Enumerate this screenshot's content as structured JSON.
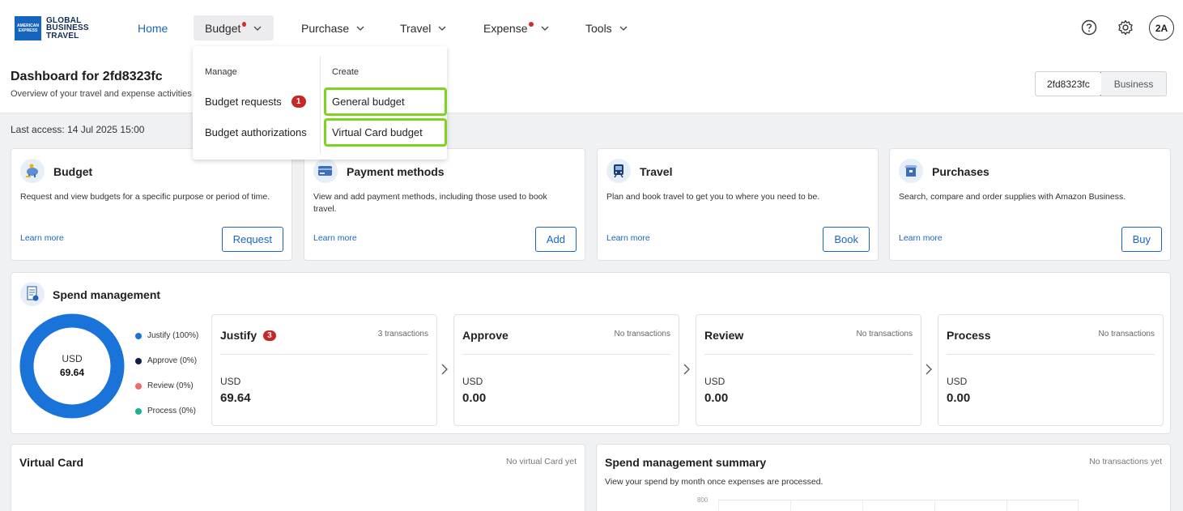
{
  "brand": {
    "line1": "GLOBAL",
    "line2": "BUSINESS",
    "line3": "TRAVEL",
    "mark": "AMERICAN EXPRESS"
  },
  "nav": {
    "home": "Home",
    "budget": "Budget",
    "purchase": "Purchase",
    "travel": "Travel",
    "expense": "Expense",
    "tools": "Tools",
    "avatar": "2A"
  },
  "header": {
    "title": "Dashboard for 2fd8323fc",
    "subtitle": "Overview of your travel and expense activities",
    "segments": [
      "2fd8323fc",
      "Business"
    ]
  },
  "last_access": "Last access: 14 Jul 2025 15:00",
  "quick_cards": [
    {
      "title": "Budget",
      "desc": "Request and view budgets for a specific purpose or period of time.",
      "link": "Learn more",
      "button": "Request",
      "icon": "piggy-bank-icon"
    },
    {
      "title": "Payment methods",
      "desc": "View and add payment methods, including those used to book travel.",
      "link": "Learn more",
      "button": "Add",
      "icon": "wallet-icon"
    },
    {
      "title": "Travel",
      "desc": "Plan and book travel to get you to where you need to be.",
      "link": "Learn more",
      "button": "Book",
      "icon": "train-icon"
    },
    {
      "title": "Purchases",
      "desc": "Search, compare and order supplies with Amazon Business.",
      "link": "Learn more",
      "button": "Buy",
      "icon": "package-icon"
    }
  ],
  "spend": {
    "title": "Spend management",
    "donut": {
      "currency": "USD",
      "amount": "69.64",
      "justify_fraction": 1.0
    },
    "legend": [
      {
        "label": "Justify (100%)",
        "color": "#1a73d9"
      },
      {
        "label": "Approve (0%)",
        "color": "#0d1f4d"
      },
      {
        "label": "Review (0%)",
        "color": "#f06a6a"
      },
      {
        "label": "Process (0%)",
        "color": "#1ab394"
      }
    ],
    "stages": [
      {
        "title": "Justify",
        "badge": "3",
        "count": "3 transactions",
        "currency": "USD",
        "amount": "69.64"
      },
      {
        "title": "Approve",
        "count": "No transactions",
        "currency": "USD",
        "amount": "0.00"
      },
      {
        "title": "Review",
        "count": "No transactions",
        "currency": "USD",
        "amount": "0.00"
      },
      {
        "title": "Process",
        "count": "No transactions",
        "currency": "USD",
        "amount": "0.00"
      }
    ]
  },
  "virtual_card": {
    "title": "Virtual Card",
    "note": "No virtual Card yet"
  },
  "summary": {
    "title": "Spend management summary",
    "note": "No transactions yet",
    "sub": "View your spend by month once expenses are processed.",
    "axis_top": "800"
  },
  "dropdown": {
    "manage_head": "Manage",
    "create_head": "Create",
    "budget_requests": "Budget requests",
    "budget_requests_badge": "1",
    "budget_authorizations": "Budget authorizations",
    "general_budget": "General budget",
    "virtual_card_budget": "Virtual Card budget"
  },
  "colors": {
    "accent": "#1a66c2",
    "highlight": "#7ed321",
    "badge": "#c62828"
  }
}
